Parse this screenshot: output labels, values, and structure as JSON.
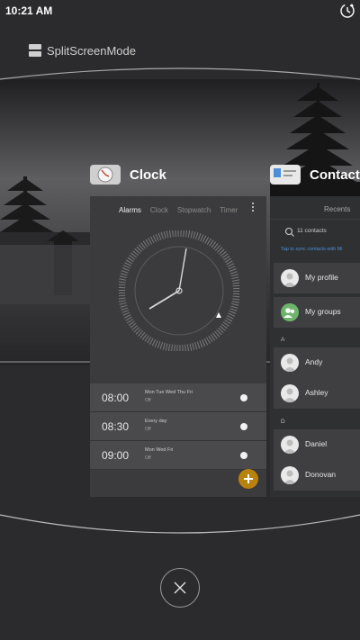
{
  "status_bar": {
    "time": "10:21 AM",
    "right_icon": "sync-clock-icon"
  },
  "header": {
    "label": "SplitScreenMode",
    "icon": "split-screen-icon"
  },
  "recent_apps": {
    "clock": {
      "name": "Clock",
      "tabs": [
        {
          "label": "Alarms",
          "active": true
        },
        {
          "label": "Clock",
          "active": false
        },
        {
          "label": "Stopwatch",
          "active": false
        },
        {
          "label": "Timer",
          "active": false
        }
      ],
      "alarms": [
        {
          "time": "08:00",
          "days": "Mon Tue Wed Thu Fri",
          "state": "Off"
        },
        {
          "time": "08:30",
          "days": "Every day",
          "state": "Off"
        },
        {
          "time": "09:00",
          "days": "Mon Wed Fri",
          "state": "Off"
        }
      ],
      "accent": "#b8820e"
    },
    "contacts": {
      "name": "Contacts",
      "tab": "Recents",
      "search_text": "11 contacts",
      "sync_hint": "Tap to sync contacts with Mi",
      "rows": {
        "my_profile": "My profile",
        "my_groups": "My groups"
      },
      "sections": [
        {
          "letter": "A",
          "contacts": [
            "Andy",
            "Ashley"
          ]
        },
        {
          "letter": "D",
          "contacts": [
            "Daniel",
            "Donovan"
          ]
        }
      ]
    }
  },
  "close_icon": "close-icon"
}
